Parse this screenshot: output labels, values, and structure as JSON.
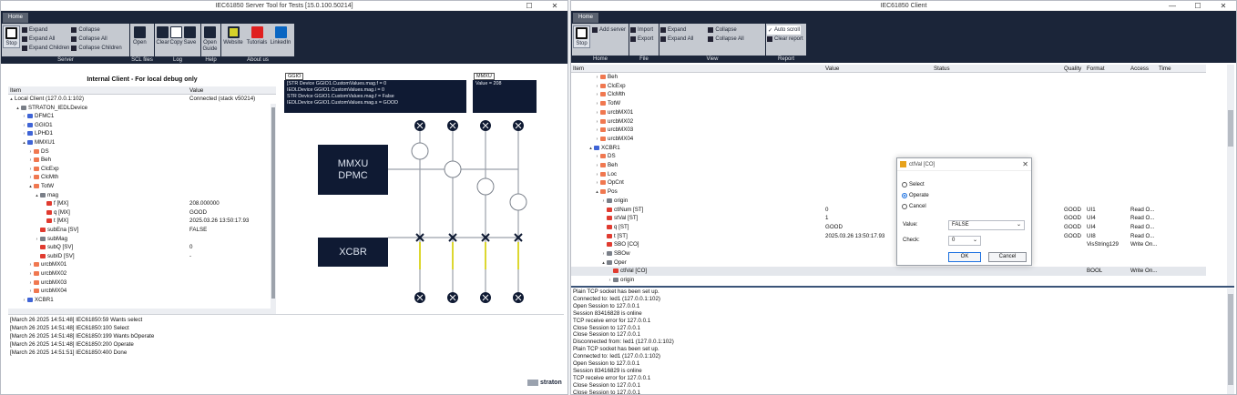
{
  "server": {
    "title": "IEC61850 Server Tool for Tests [15.0.100.50214]",
    "tab": "Home",
    "stop": "Stop",
    "expand": "Expand",
    "expand_all": "Expand All",
    "expand_children": "Expand Children",
    "collapse": "Collapse",
    "collapse_all": "Collapse All",
    "collapse_children": "Collapse Children",
    "open": "Open",
    "clear": "Clear",
    "copy": "Copy",
    "save": "Save",
    "open_guide": "Open Guide",
    "website": "Website",
    "tutorials": "Tutorials",
    "linkedin": "LinkedIn",
    "groups": {
      "server": "Server",
      "scl": "SCL files",
      "log": "Log",
      "help": "Help",
      "about": "About us"
    },
    "panel_title": "Internal Client - For local debug only",
    "col_item": "Item",
    "col_value": "Value",
    "tree": [
      {
        "label": "Local Client (127.0.0.1:102)",
        "value": "Connected (stack v50214)"
      },
      {
        "label": "STRATON_IEDLDevice",
        "value": ""
      },
      {
        "label": "DFMC1",
        "value": ""
      },
      {
        "label": "GGIO1",
        "value": ""
      },
      {
        "label": "LPHD1",
        "value": ""
      },
      {
        "label": "MMXU1",
        "value": ""
      },
      {
        "label": "DS",
        "value": ""
      },
      {
        "label": "Beh",
        "value": ""
      },
      {
        "label": "ClcExp",
        "value": ""
      },
      {
        "label": "ClcMth",
        "value": ""
      },
      {
        "label": "TotW",
        "value": ""
      },
      {
        "label": "mag",
        "value": ""
      },
      {
        "label": "f [MX]",
        "value": "208.000000"
      },
      {
        "label": "q [MX]",
        "value": "GOOD"
      },
      {
        "label": "t [MX]",
        "value": "2025.03.26 13:50:17.93"
      },
      {
        "label": "subEna [SV]",
        "value": "FALSE"
      },
      {
        "label": "subMag",
        "value": ""
      },
      {
        "label": "subQ [SV]",
        "value": "0"
      },
      {
        "label": "subID [SV]",
        "value": "-"
      },
      {
        "label": "urcbMX01",
        "value": ""
      },
      {
        "label": "urcbMX02",
        "value": ""
      },
      {
        "label": "urcbMX03",
        "value": ""
      },
      {
        "label": "urcbMX04",
        "value": ""
      },
      {
        "label": "XCBR1",
        "value": ""
      }
    ],
    "ggio_label": "GGIO",
    "ggio_lines": [
      "[STR Device GGIO1.CustomValues.mag.f = 0",
      "IEDLDevice GGIO1.CustomValues.mag.i = 0",
      "STR Device GGIO1.CustomValues.mag.f = False",
      "IEDLDevice GGIO1.CustomValues.mag.s = GOOD"
    ],
    "mmxu_label": "MMXU",
    "mmxu_value": "Value = 208",
    "box_mmxu": "MMXU",
    "box_dpmc": "DPMC",
    "box_xcbr": "XCBR",
    "log": [
      "[March 26 2025 14:51:48] IEC61850:59 Wants select",
      "[March 26 2025 14:51:48] IEC61850:100 Select",
      "[March 26 2025 14:51:48] IEC61850:199 Wants bOperate",
      "[March 26 2025 14:51:48] IEC61850:200 Operate",
      "[March 26 2025 14:51:51] IEC61850:400 Done"
    ],
    "brand": "straton"
  },
  "client": {
    "title": "IEC61850 Client",
    "tab": "Home",
    "stop": "Stop",
    "add_server": "Add server",
    "import": "Import",
    "export": "Export",
    "expand": "Expand",
    "expand_all": "Expand All",
    "collapse": "Collapse",
    "collapse_all": "Collapse All",
    "auto_scroll": "Auto scroll",
    "clear_report": "Clear report",
    "groups": {
      "home": "Home",
      "file": "File",
      "view": "View",
      "report": "Report"
    },
    "cols": [
      "Item",
      "Value",
      "Status",
      "Quality",
      "Format",
      "Access",
      "Time"
    ],
    "tree": [
      {
        "label": "Beh",
        "value": "",
        "quality": "",
        "format": "",
        "access": ""
      },
      {
        "label": "ClcExp",
        "value": "",
        "quality": "",
        "format": "",
        "access": ""
      },
      {
        "label": "ClcMth",
        "value": "",
        "quality": "",
        "format": "",
        "access": ""
      },
      {
        "label": "TotW",
        "value": "",
        "quality": "",
        "format": "",
        "access": ""
      },
      {
        "label": "urcbMX01",
        "value": "",
        "quality": "",
        "format": "",
        "access": ""
      },
      {
        "label": "urcbMX02",
        "value": "",
        "quality": "",
        "format": "",
        "access": ""
      },
      {
        "label": "urcbMX03",
        "value": "",
        "quality": "",
        "format": "",
        "access": ""
      },
      {
        "label": "urcbMX04",
        "value": "",
        "quality": "",
        "format": "",
        "access": ""
      },
      {
        "label": "XCBR1",
        "value": "",
        "quality": "",
        "format": "",
        "access": ""
      },
      {
        "label": "DS",
        "value": "",
        "quality": "",
        "format": "",
        "access": ""
      },
      {
        "label": "Beh",
        "value": "",
        "quality": "",
        "format": "",
        "access": ""
      },
      {
        "label": "Loc",
        "value": "",
        "quality": "",
        "format": "",
        "access": ""
      },
      {
        "label": "OpCnt",
        "value": "",
        "quality": "",
        "format": "",
        "access": ""
      },
      {
        "label": "Pos",
        "value": "",
        "quality": "",
        "format": "",
        "access": ""
      },
      {
        "label": "origin",
        "value": "",
        "quality": "",
        "format": "",
        "access": ""
      },
      {
        "label": "ctlNum [ST]",
        "value": "0",
        "quality": "GOOD",
        "format": "UI1",
        "access": "Read O..."
      },
      {
        "label": "stVal [ST]",
        "value": "1",
        "quality": "GOOD",
        "format": "UI4",
        "access": "Read O..."
      },
      {
        "label": "q [ST]",
        "value": "GOOD",
        "quality": "GOOD",
        "format": "UI4",
        "access": "Read O..."
      },
      {
        "label": "t [ST]",
        "value": "2025.03.26 13:50:17.93",
        "quality": "GOOD",
        "format": "UI8",
        "access": "Read O..."
      },
      {
        "label": "SBO [CO]",
        "value": "",
        "quality": "",
        "format": "VisString129",
        "access": "Write On..."
      },
      {
        "label": "SBOw",
        "value": "",
        "quality": "",
        "format": "",
        "access": ""
      },
      {
        "label": "Oper",
        "value": "",
        "quality": "",
        "format": "",
        "access": ""
      },
      {
        "label": "ctlVal [CO]",
        "value": "",
        "quality": "",
        "format": "BOOL",
        "access": "Write On..."
      },
      {
        "label": "origin",
        "value": "",
        "quality": "",
        "format": "",
        "access": ""
      }
    ],
    "log": [
      "Plain TCP socket has been set up.",
      "Connected to: Ied1 (127.0.0.1:102)",
      "Open Session to 127.0.0.1",
      "Session 83416828 is online",
      "TCP receive error for 127.0.0.1",
      "Close Session to 127.0.0.1",
      "Close Session to 127.0.0.1",
      "Disconnected from: Ied1 (127.0.0.1:102)",
      "Plain TCP socket has been set up.",
      "Connected to: Ied1 (127.0.0.1:102)",
      "Open Session to 127.0.0.1",
      "Session 83416829 is online",
      "TCP receive error for 127.0.0.1",
      "Close Session to 127.0.0.1",
      "Close Session to 127.0.0.1"
    ],
    "dialog": {
      "title": "ctlVal [CO]",
      "select": "Select",
      "operate": "Operate",
      "cancel_radio": "Cancel",
      "value_label": "Value:",
      "value": "FALSE",
      "check_label": "Check:",
      "check": "0",
      "ok": "OK",
      "cancel": "Cancel"
    }
  }
}
